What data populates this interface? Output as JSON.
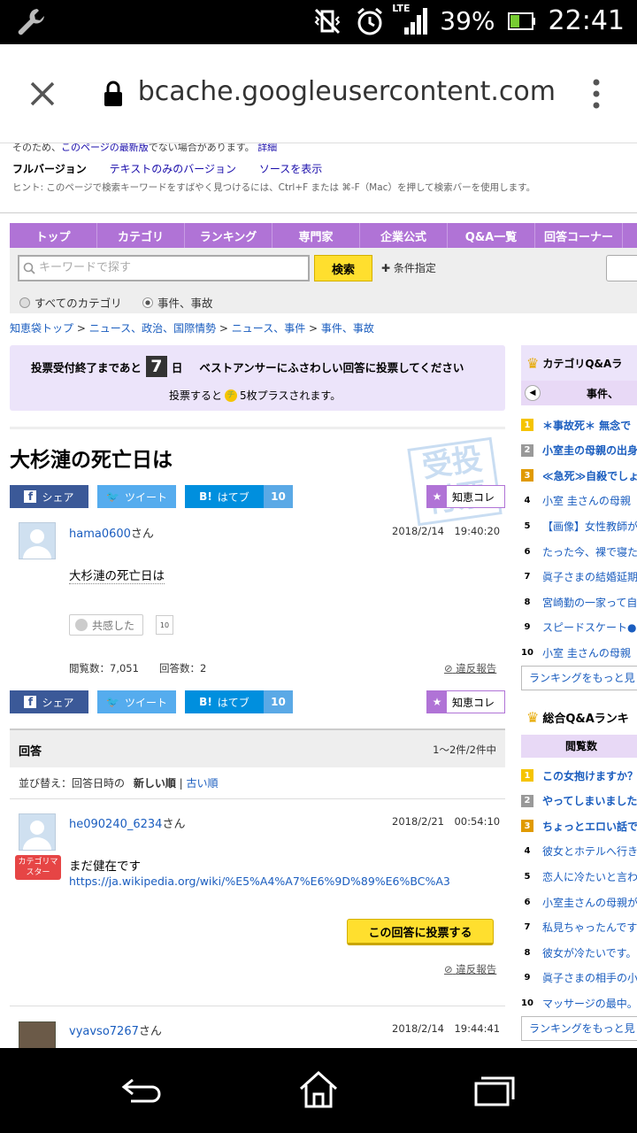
{
  "status_bar": {
    "battery": "39%",
    "time": "22:41",
    "network": "LTE"
  },
  "browser": {
    "url": "webcache.googleusercontent.com"
  },
  "cache_notice": {
    "line1_prefix": "そのため、",
    "line1_link": "このページの最新版",
    "line1_suffix": "でない場合があります。",
    "line1_detail": "詳細",
    "full_version": "フルバージョン",
    "text_only": "テキストのみのバージョン",
    "view_source": "ソースを表示",
    "hint": "ヒント: このページで検索キーワードをすばやく見つけるには、Ctrl+F または ⌘-F（Mac）を押して検索バーを使用します。"
  },
  "nav_tabs": [
    "トップ",
    "カテゴリ",
    "ランキング",
    "専門家",
    "企業公式",
    "Q&A一覧",
    "回答コーナー"
  ],
  "search": {
    "placeholder": "キーワードで探す",
    "button": "検索",
    "condition": "条件指定",
    "radio_all": "すべてのカテゴリ",
    "radio_cat": "事件、事故"
  },
  "breadcrumb": [
    "知恵袋トップ",
    "ニュース、政治、国際情勢",
    "ニュース、事件",
    "事件、事故"
  ],
  "vote_box": {
    "prefix": "投票受付終了まであと",
    "days": "7",
    "day_unit": "日",
    "message": "ベストアンサーにふさわしい回答に投票してください",
    "line2_prefix": "投票すると",
    "coin": "チ",
    "line2_suffix": "5枚プラスされます。"
  },
  "question": {
    "title": "大杉漣の死亡日は",
    "user": "hama0600",
    "san": "さん",
    "date": "2018/2/14　19:40:20",
    "body": "大杉漣の死亡日は",
    "empathy": "共感した",
    "empathy_count": "10",
    "views": "閲覧数：7,051",
    "answers": "回答数：2",
    "report": "違反報告",
    "stamp": "受投\n付票"
  },
  "share": {
    "facebook": "シェア",
    "twitter": "ツイート",
    "hatena": "はてブ",
    "hatena_count": "10",
    "chie": "知恵コレ"
  },
  "answers_header": {
    "title": "回答",
    "count": "1〜2件/2件中",
    "sort_label": "並び替え：回答日時の",
    "sort_new": "新しい順",
    "sort_old": "古い順"
  },
  "answer1": {
    "user": "he090240_6234",
    "san": "さん",
    "date": "2018/2/21　00:54:10",
    "badge": "カテゴリマスター",
    "body": "まだ健在です",
    "link": "https://ja.wikipedia.org/wiki/%E5%A4%A7%E6%9D%89%E6%BC%A3",
    "vote_button": "この回答に投票する",
    "report": "違反報告"
  },
  "answer2": {
    "user": "vyavso7267",
    "san": "さん",
    "date": "2018/2/14　19:44:41"
  },
  "sidebar": {
    "cat_title": "カテゴリQ&Aラ",
    "cat_sub": "事件、",
    "cat_items": [
      "＊事故死＊ 無念で",
      "小室圭の母親の出身",
      "≪急死≫自殺でしょ",
      "小室 圭さんの母親",
      "【画像】女性教師が",
      "たった今、裸で寝た",
      "眞子さまの結婚延期",
      "宮崎勤の一家って自",
      "スピードスケート●",
      "小室 圭さんの母親"
    ],
    "more1": "ランキングをもっと見",
    "gen_title": "総合Q&Aランキ",
    "gen_sub": "閲覧数",
    "gen_items": [
      "この女抱けますか？",
      "やってしまいました",
      "ちょっとエロい話で",
      "彼女とホテルへ行き",
      "恋人に冷たいと言わ",
      "小室圭さんの母親が",
      "私見ちゃったんです",
      "彼女が冷たいです。",
      "眞子さまの相手の小",
      "マッサージの最中。"
    ],
    "more2": "ランキングをもっと見"
  }
}
